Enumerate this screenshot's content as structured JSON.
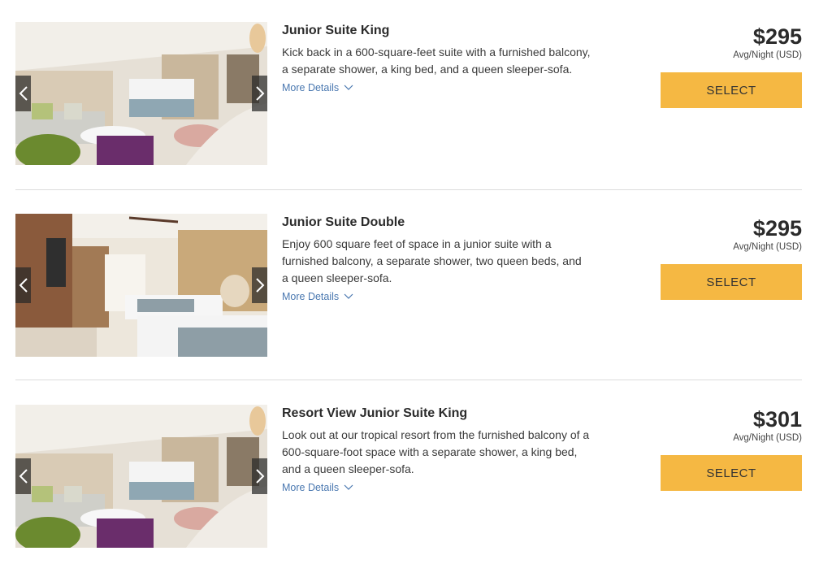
{
  "rooms": [
    {
      "title": "Junior Suite King",
      "description": "Kick back in a 600-square-feet suite with a furnished balcony, a separate shower, a king bed, and a queen sleeper-sofa.",
      "more_details": "More Details",
      "price": "$295",
      "price_note": "Avg/Night (USD)",
      "select_label": "SELECT",
      "photo": "suite-king-living-area"
    },
    {
      "title": "Junior Suite Double",
      "description": "Enjoy 600 square feet of space in a junior suite with a furnished balcony, a separate shower, two queen beds, and a queen sleeper-sofa.",
      "more_details": "More Details",
      "price": "$295",
      "price_note": "Avg/Night (USD)",
      "select_label": "SELECT",
      "photo": "suite-double-beds"
    },
    {
      "title": "Resort View Junior Suite King",
      "description": "Look out at our tropical resort from the furnished balcony of a 600-square-foot space with a separate shower, a king bed, and a queen sleeper-sofa.",
      "more_details": "More Details",
      "price": "$301",
      "price_note": "Avg/Night (USD)",
      "select_label": "SELECT",
      "photo": "suite-king-living-area"
    }
  ],
  "icons": {
    "prev": "chevron-left-icon",
    "next": "chevron-right-icon",
    "expand": "chevron-down-icon"
  },
  "colors": {
    "select_button": "#f5b843",
    "link": "#4a78b0",
    "divider": "#dcdcdc"
  }
}
